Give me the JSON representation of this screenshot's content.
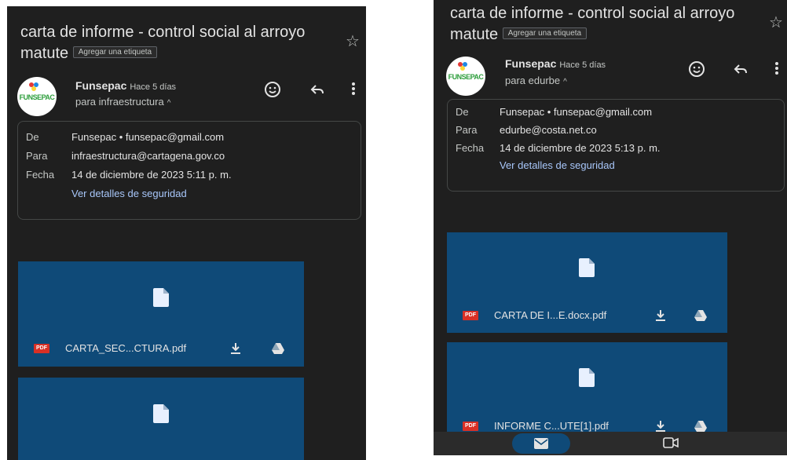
{
  "left": {
    "subject": "carta de informe - control social al arroyo matute",
    "label_chip": "Agregar una etiqueta",
    "avatar_text": "FUNSEPAC",
    "sender_name": "Funsepac",
    "time": "Hace 5 días",
    "recipient_line": "para infraestructura",
    "details": {
      "from_label": "De",
      "from_value": "Funsepac • funsepac@gmail.com",
      "to_label": "Para",
      "to_value": "infraestructura@cartagena.gov.co",
      "date_label": "Fecha",
      "date_value": "14 de diciembre de 2023 5:11 p. m.",
      "security_link": "Ver detalles de seguridad"
    },
    "attachments": [
      {
        "badge": "PDF",
        "name": "CARTA_SEC...CTURA.pdf"
      }
    ]
  },
  "right": {
    "subject": "carta de informe - control social al arroyo matute",
    "label_chip": "Agregar una etiqueta",
    "avatar_text": "FUNSEPAC",
    "sender_name": "Funsepac",
    "time": "Hace 5 días",
    "recipient_line": "para edurbe",
    "details": {
      "from_label": "De",
      "from_value": "Funsepac • funsepac@gmail.com",
      "to_label": "Para",
      "to_value": "edurbe@costa.net.co",
      "date_label": "Fecha",
      "date_value": "14 de diciembre de 2023 5:13 p. m.",
      "security_link": "Ver detalles de seguridad"
    },
    "attachments": [
      {
        "badge": "PDF",
        "name": "CARTA DE I...E.docx.pdf"
      },
      {
        "badge": "PDF",
        "name": "INFORME C...UTE[1].pdf"
      }
    ]
  },
  "colors": {
    "background": "#1f1f1f",
    "attachment": "#0f4a78",
    "link": "#a8c7fa",
    "pdf": "#d93025"
  }
}
